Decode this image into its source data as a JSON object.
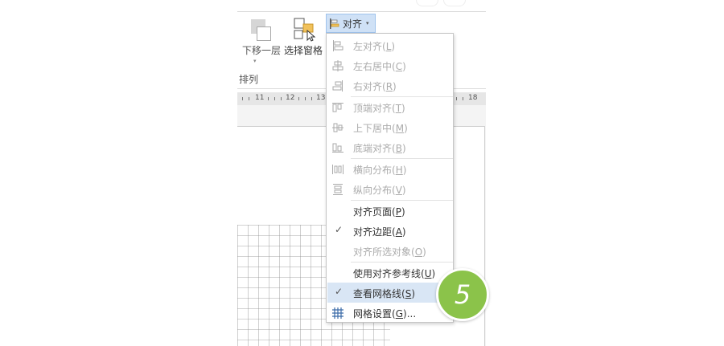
{
  "ribbon": {
    "send_backward_label": "下移一层",
    "selection_pane_label": "选择窗格",
    "align_button_label": "对齐",
    "group_label": "排列"
  },
  "ruler": {
    "ticks": [
      "11",
      "12",
      "13",
      "18"
    ]
  },
  "align_menu": {
    "items": [
      {
        "label": "左对齐",
        "key": "L",
        "icon": "align-left-icon",
        "enabled": false
      },
      {
        "label": "左右居中",
        "key": "C",
        "icon": "align-center-icon",
        "enabled": false
      },
      {
        "label": "右对齐",
        "key": "R",
        "icon": "align-right-icon",
        "enabled": false
      },
      {
        "label": "顶端对齐",
        "key": "T",
        "icon": "align-top-icon",
        "enabled": false
      },
      {
        "label": "上下居中",
        "key": "M",
        "icon": "align-middle-icon",
        "enabled": false
      },
      {
        "label": "底端对齐",
        "key": "B",
        "icon": "align-bottom-icon",
        "enabled": false
      },
      {
        "label": "横向分布",
        "key": "H",
        "icon": "distribute-horizontal-icon",
        "enabled": false
      },
      {
        "label": "纵向分布",
        "key": "V",
        "icon": "distribute-vertical-icon",
        "enabled": false
      },
      {
        "label": "对齐页面",
        "key": "P",
        "enabled": true,
        "checked": false
      },
      {
        "label": "对齐边距",
        "key": "A",
        "enabled": true,
        "checked": true
      },
      {
        "label": "对齐所选对象",
        "key": "O",
        "enabled": false,
        "checked": false
      },
      {
        "label": "使用对齐参考线",
        "key": "U",
        "enabled": true,
        "checked": false
      },
      {
        "label": "查看网格线",
        "key": "S",
        "enabled": true,
        "checked": true,
        "highlighted": true
      },
      {
        "label": "网格设置",
        "key": "G",
        "suffix": "...",
        "icon": "grid-settings-icon",
        "enabled": true
      }
    ]
  },
  "step_badge": "5",
  "colors": {
    "accent_highlight": "#d9e6f5",
    "align_button_bg": "#cfe1f6",
    "badge_green": "#8bc34a",
    "disabled_text": "#ababab"
  }
}
